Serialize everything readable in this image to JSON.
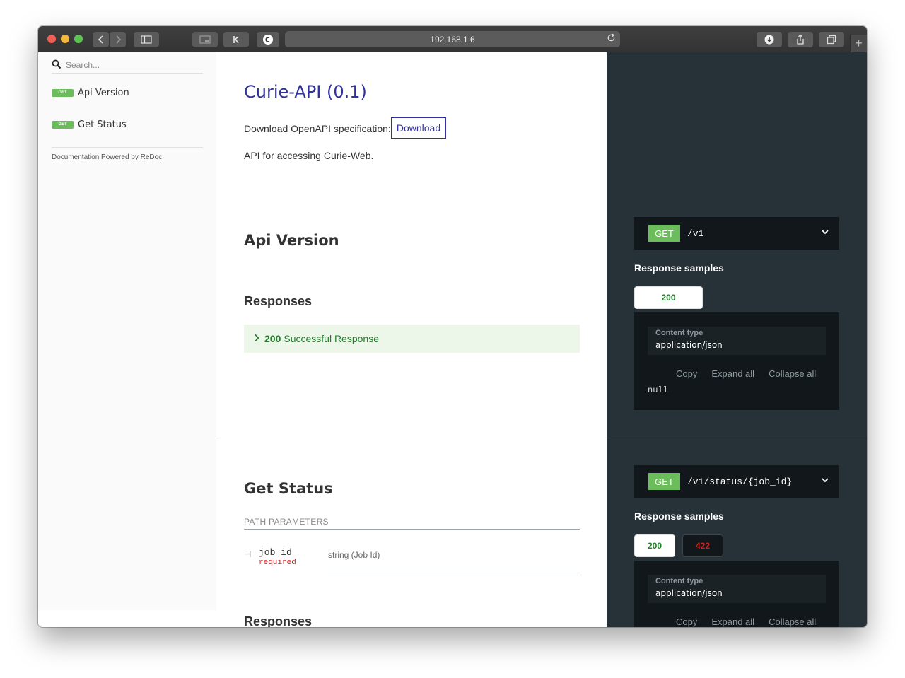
{
  "browser": {
    "url": "192.168.1.6",
    "new_tab_glyph": "+"
  },
  "sidebar": {
    "search": {
      "placeholder": "Search..."
    },
    "items": [
      {
        "badge": "GET",
        "label": "Api Version"
      },
      {
        "badge": "GET",
        "label": "Get Status"
      }
    ],
    "powered_by": "Documentation Powered by ReDoc"
  },
  "intro": {
    "title": "Curie-API (0.1)",
    "download_label": "Download OpenAPI specification:",
    "download_button": "Download",
    "description": "API for accessing Curie-Web."
  },
  "operations": [
    {
      "title": "Api Version",
      "responses_title": "Responses",
      "responses": [
        {
          "code": "200",
          "text": "Successful Response"
        }
      ],
      "method": "GET",
      "path": "/v1",
      "samples_title": "Response samples",
      "tabs": [
        "200"
      ],
      "content_type_label": "Content type",
      "content_type": "application/json",
      "actions": [
        "Copy",
        "Expand all",
        "Collapse all"
      ],
      "sample_body": "null"
    },
    {
      "title": "Get Status",
      "path_params_title": "PATH PARAMETERS",
      "params": [
        {
          "name": "job_id",
          "required": "required",
          "type": "string (Job Id)"
        }
      ],
      "responses_title": "Responses",
      "method": "GET",
      "path": "/v1/status/{job_id}",
      "samples_title": "Response samples",
      "tabs": [
        "200",
        "422"
      ],
      "content_type_label": "Content type",
      "content_type": "application/json",
      "actions": [
        "Copy",
        "Expand all",
        "Collapse all"
      ]
    }
  ],
  "colors": {
    "accent": "#32329f",
    "get_badge": "#6bbd5b",
    "success_text": "#1d8127",
    "error_text": "#d41f1c",
    "right_panel": "#263238"
  }
}
